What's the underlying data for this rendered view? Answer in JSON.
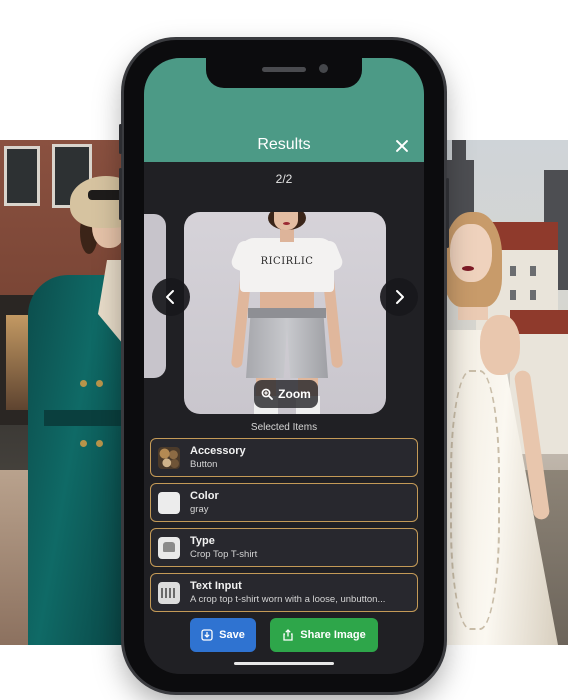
{
  "header": {
    "title": "Results"
  },
  "carousel": {
    "counter": "2/2",
    "image_print_text": "RICIRLIC",
    "zoom_label": "Zoom"
  },
  "selected": {
    "heading": "Selected Items",
    "items": [
      {
        "title": "Accessory",
        "value": "Button",
        "icon": "accessory-thumbnail"
      },
      {
        "title": "Color",
        "value": "gray",
        "icon": "color-swatch"
      },
      {
        "title": "Type",
        "value": "Crop Top T-shirt",
        "icon": "tshirt-thumbnail"
      },
      {
        "title": "Text Input",
        "value": "A crop top t-shirt worn with a loose, unbutton...",
        "icon": "keyboard-icon"
      }
    ]
  },
  "actions": {
    "save_label": "Save",
    "share_label": "Share Image"
  },
  "colors": {
    "header": "#4c9a86",
    "item_border": "#c49a57",
    "save": "#2f73d1",
    "share": "#2ea64a"
  }
}
